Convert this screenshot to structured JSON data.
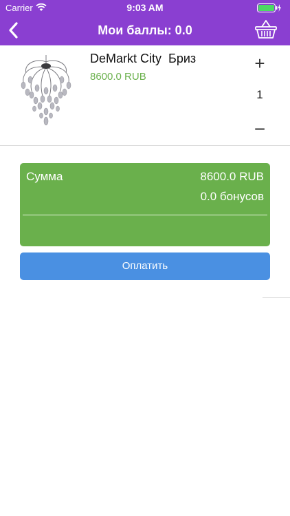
{
  "status_bar": {
    "carrier": "Carrier",
    "time": "9:03 AM"
  },
  "nav": {
    "title": "Мои баллы: 0.0",
    "back_icon": "chevron-left-icon",
    "basket_icon": "basket-icon"
  },
  "cart": {
    "items": [
      {
        "name": "DeMarkt City  Бриз",
        "price": "8600.0 RUB",
        "quantity": "1",
        "plus_label": "+",
        "minus_label": "−"
      }
    ]
  },
  "summary": {
    "label": "Сумма",
    "amount": "8600.0 RUB",
    "bonus": "0.0 бонусов"
  },
  "pay_button": {
    "label": "Оплатить"
  },
  "colors": {
    "header": "#8a3fd1",
    "price_green": "#6ab04c",
    "pay_blue": "#4a90e2"
  }
}
